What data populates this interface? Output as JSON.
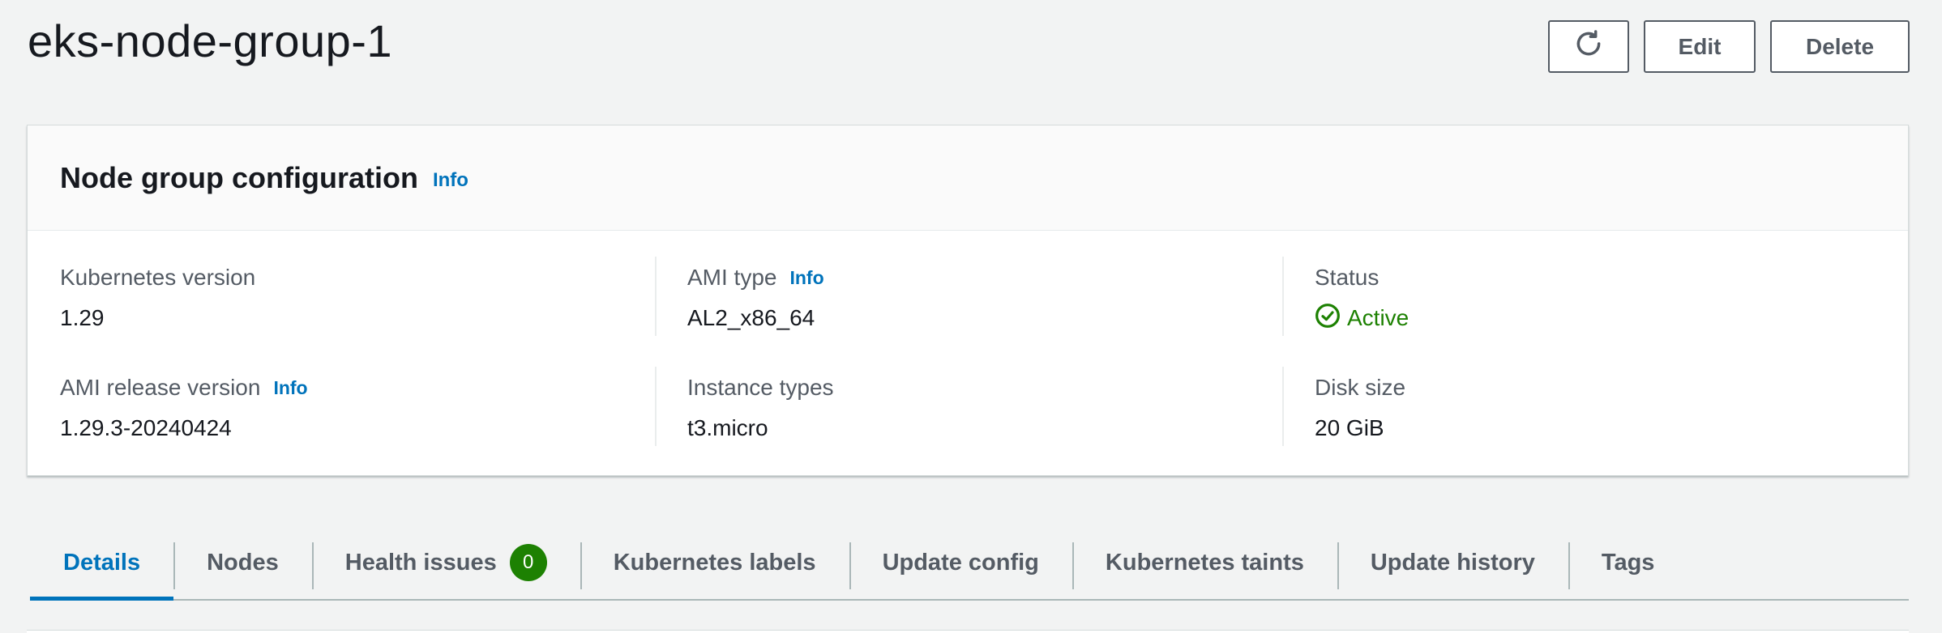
{
  "header": {
    "title": "eks-node-group-1",
    "buttons": {
      "refresh_icon": "refresh-icon",
      "edit_label": "Edit",
      "delete_label": "Delete"
    }
  },
  "config_card": {
    "title": "Node group configuration",
    "info_label": "Info",
    "fields": {
      "kubernetes_version": {
        "label": "Kubernetes version",
        "value": "1.29"
      },
      "ami_type": {
        "label": "AMI type",
        "info": "Info",
        "value": "AL2_x86_64"
      },
      "status": {
        "label": "Status",
        "value": "Active",
        "icon": "check-circle-icon"
      },
      "ami_release_version": {
        "label": "AMI release version",
        "info": "Info",
        "value": "1.29.3-20240424"
      },
      "instance_types": {
        "label": "Instance types",
        "value": "t3.micro"
      },
      "disk_size": {
        "label": "Disk size",
        "value": "20 GiB"
      }
    }
  },
  "tabs": [
    {
      "label": "Details",
      "active": true
    },
    {
      "label": "Nodes"
    },
    {
      "label": "Health issues",
      "badge": "0"
    },
    {
      "label": "Kubernetes labels"
    },
    {
      "label": "Update config"
    },
    {
      "label": "Kubernetes taints"
    },
    {
      "label": "Update history"
    },
    {
      "label": "Tags"
    }
  ],
  "colors": {
    "accent": "#0073bb",
    "success": "#1d8102",
    "background": "#f2f3f3",
    "text": "#16191f",
    "secondary_text": "#545b64"
  }
}
